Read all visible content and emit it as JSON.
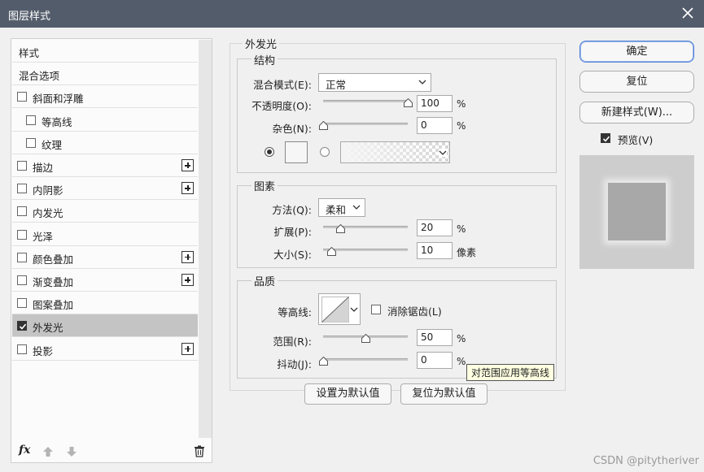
{
  "window": {
    "title": "图层样式"
  },
  "style_list": {
    "items": [
      {
        "label": "样式",
        "checkbox": false,
        "checked": false,
        "plus": false,
        "indent": false,
        "selected": false
      },
      {
        "label": "混合选项",
        "checkbox": false,
        "checked": false,
        "plus": false,
        "indent": false,
        "selected": false
      },
      {
        "label": "斜面和浮雕",
        "checkbox": true,
        "checked": false,
        "plus": false,
        "indent": false,
        "selected": false
      },
      {
        "label": "等高线",
        "checkbox": true,
        "checked": false,
        "plus": false,
        "indent": true,
        "selected": false
      },
      {
        "label": "纹理",
        "checkbox": true,
        "checked": false,
        "plus": false,
        "indent": true,
        "selected": false
      },
      {
        "label": "描边",
        "checkbox": true,
        "checked": false,
        "plus": true,
        "indent": false,
        "selected": false
      },
      {
        "label": "内阴影",
        "checkbox": true,
        "checked": false,
        "plus": true,
        "indent": false,
        "selected": false
      },
      {
        "label": "内发光",
        "checkbox": true,
        "checked": false,
        "plus": false,
        "indent": false,
        "selected": false
      },
      {
        "label": "光泽",
        "checkbox": true,
        "checked": false,
        "plus": false,
        "indent": false,
        "selected": false
      },
      {
        "label": "颜色叠加",
        "checkbox": true,
        "checked": false,
        "plus": true,
        "indent": false,
        "selected": false
      },
      {
        "label": "渐变叠加",
        "checkbox": true,
        "checked": false,
        "plus": true,
        "indent": false,
        "selected": false
      },
      {
        "label": "图案叠加",
        "checkbox": true,
        "checked": false,
        "plus": false,
        "indent": false,
        "selected": false
      },
      {
        "label": "外发光",
        "checkbox": true,
        "checked": true,
        "plus": false,
        "indent": false,
        "selected": true
      },
      {
        "label": "投影",
        "checkbox": true,
        "checked": false,
        "plus": true,
        "indent": false,
        "selected": false
      }
    ],
    "fx_icon": "fx"
  },
  "outer_glow": {
    "title": "外发光",
    "structure": {
      "title": "结构",
      "blend_mode_label": "混合模式(E):",
      "blend_mode_value": "正常",
      "opacity_label": "不透明度(O):",
      "opacity_value": "100",
      "opacity_unit": "%",
      "opacity_level": 1.0,
      "noise_label": "杂色(N):",
      "noise_value": "0",
      "noise_unit": "%",
      "noise_level": 0.0
    },
    "elements": {
      "title": "图素",
      "technique_label": "方法(Q):",
      "technique_value": "柔和",
      "spread_label": "扩展(P):",
      "spread_value": "20",
      "spread_unit": "%",
      "spread_level": 0.2,
      "size_label": "大小(S):",
      "size_value": "10",
      "size_unit": "像素",
      "size_level": 0.1
    },
    "quality": {
      "title": "品质",
      "contour_label": "等高线:",
      "antialias_label": "消除锯齿(L)",
      "antialias_checked": false,
      "range_label": "范围(R):",
      "range_value": "50",
      "range_unit": "%",
      "range_level": 0.5,
      "jitter_label": "抖动(J):",
      "jitter_value": "0",
      "jitter_unit": "%",
      "jitter_level": 0.0
    },
    "set_default_label": "设置为默认值",
    "reset_default_label": "复位为默认值"
  },
  "tooltip": "对范围应用等高线",
  "right_panel": {
    "ok_label": "确定",
    "reset_label": "复位",
    "new_style_label": "新建样式(W)...",
    "preview_label": "预览(V)",
    "preview_checked": true
  },
  "watermark": "CSDN @pitytheriver",
  "colors": {
    "title_bar": "#535c6b",
    "selected_row": "#c4c4c4",
    "primary_border": "#4f7fd8",
    "tooltip_bg": "#ffffe1"
  }
}
